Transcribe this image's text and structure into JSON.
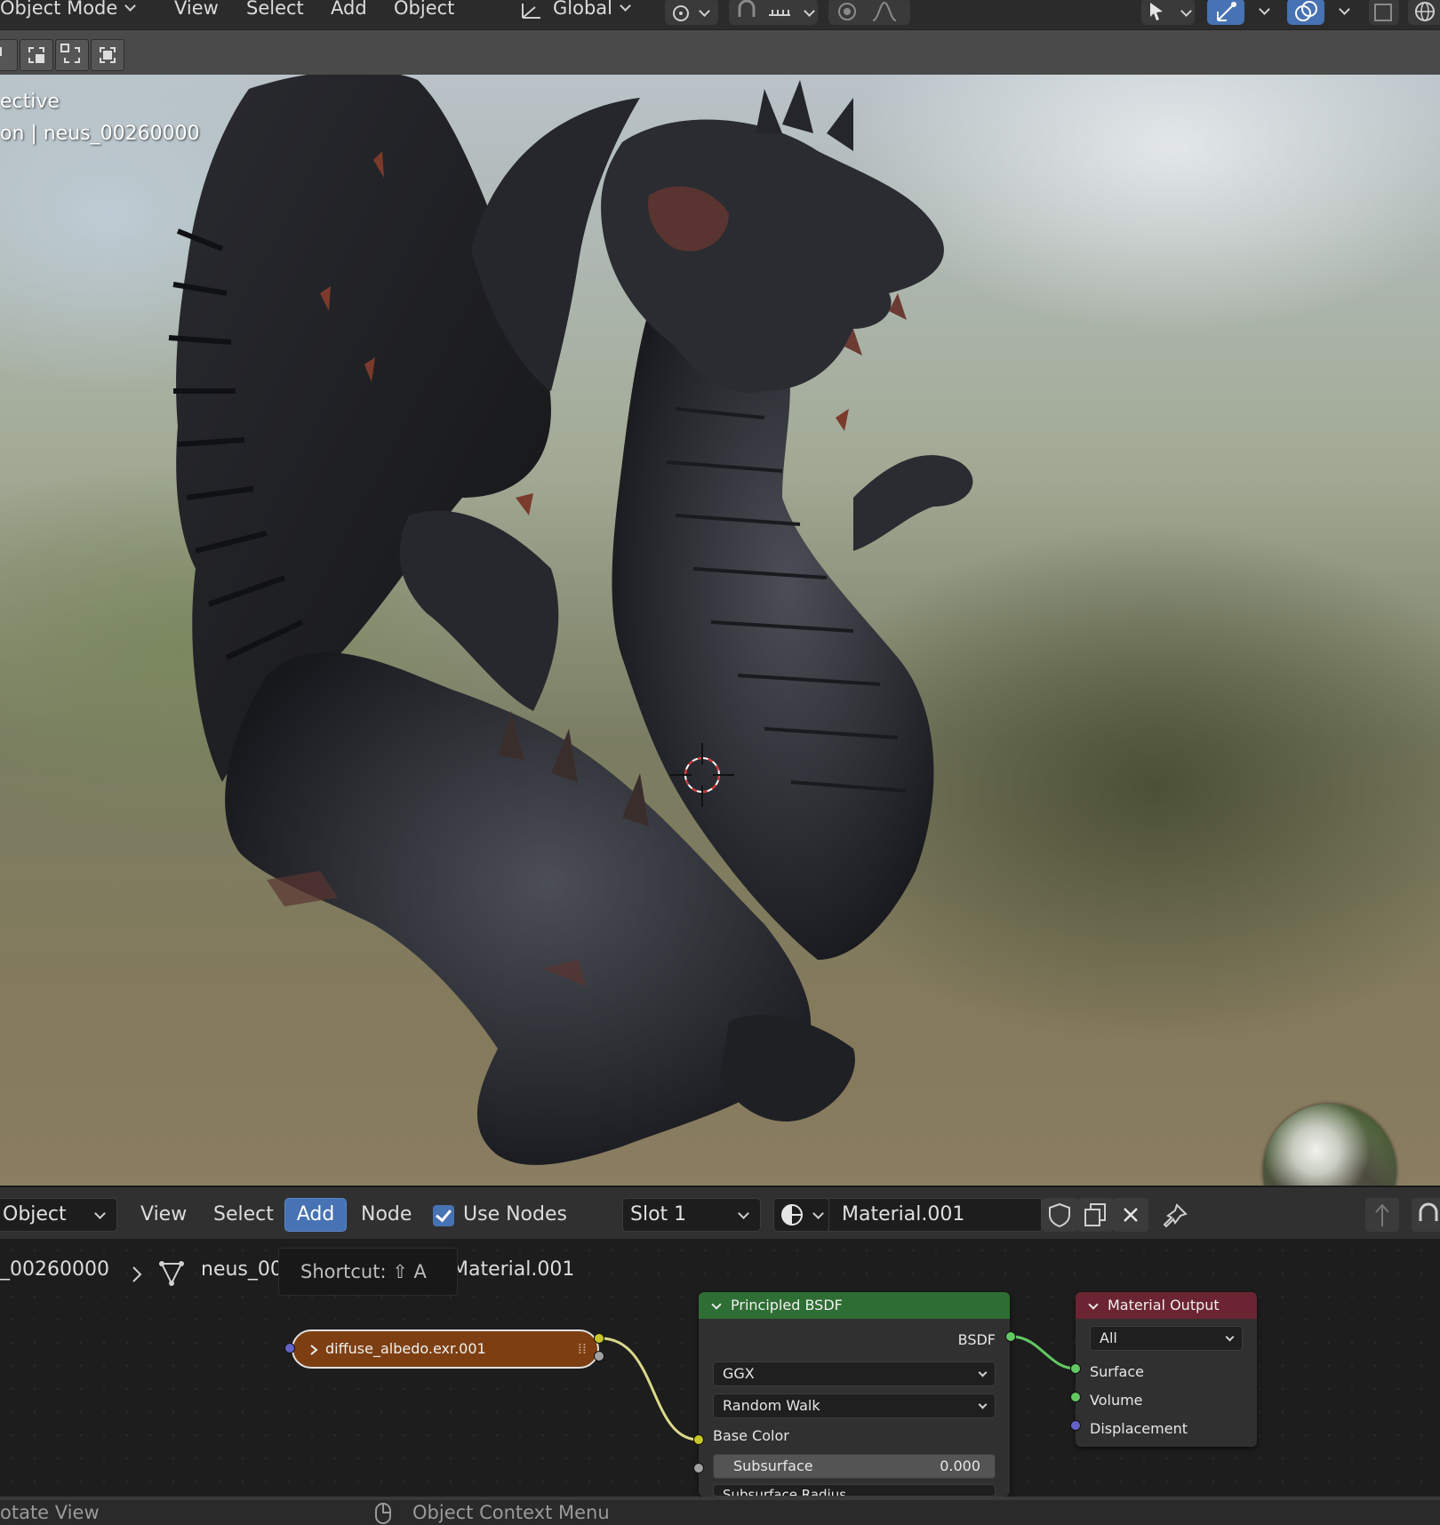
{
  "header": {
    "mode": "Object Mode",
    "menu": [
      "View",
      "Select",
      "Add",
      "Object"
    ],
    "transform_orientation": "Global"
  },
  "viewport": {
    "overlay_line1": "ective",
    "overlay_line2": "on | neus_00260000"
  },
  "node_header": {
    "editor_type": "Object",
    "menu": [
      "View",
      "Select",
      "Add",
      "Node"
    ],
    "use_nodes_label": "Use Nodes",
    "use_nodes_checked": true,
    "slot": "Slot 1",
    "material_name": "Material.001"
  },
  "breadcrumbs": {
    "object": "_00260000",
    "mesh": "neus_00",
    "material": "Material.001"
  },
  "tooltip": {
    "text": "Shortcut: ⇧ A"
  },
  "nodes": {
    "image_texture": {
      "label": "diffuse_albedo.exr.001"
    },
    "principled": {
      "title": "Principled BSDF",
      "output": "BSDF",
      "distribution": "GGX",
      "subsurface_method": "Random Walk",
      "base_color": "Base Color",
      "subsurface_label": "Subsurface",
      "subsurface_value": "0.000",
      "subsurface_radius": "Subsurface Radius"
    },
    "material_output": {
      "title": "Material Output",
      "target": "All",
      "inputs": [
        "Surface",
        "Volume",
        "Displacement"
      ]
    }
  },
  "statusbar": {
    "left": "otate View",
    "middle": "Object Context Menu"
  },
  "colors": {
    "accent_blue": "#4772b3",
    "principled_header": "#2e6e34",
    "output_header": "#6b2431",
    "image_node": "#7d3f12"
  }
}
